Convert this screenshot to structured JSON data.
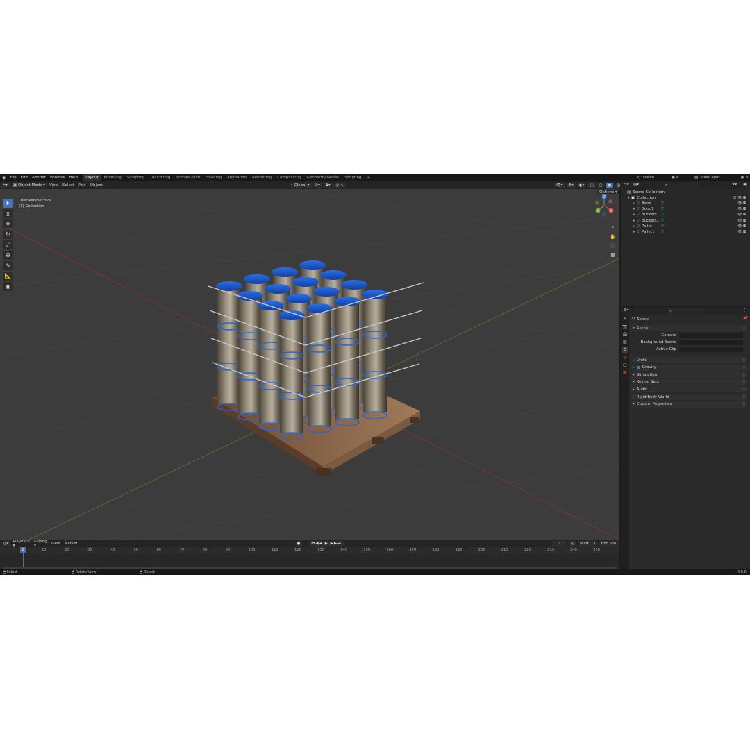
{
  "menu": [
    "File",
    "Edit",
    "Render",
    "Window",
    "Help"
  ],
  "workspaces": [
    "Layout",
    "Modeling",
    "Sculpting",
    "UV Editing",
    "Texture Paint",
    "Shading",
    "Animation",
    "Rendering",
    "Compositing",
    "Geometry Nodes",
    "Scripting",
    "+"
  ],
  "scene_name": "Scene",
  "view_layer": "ViewLayer",
  "viewport": {
    "mode": "Object Mode",
    "menus": [
      "View",
      "Select",
      "Add",
      "Object"
    ],
    "transform_orientation": "Global",
    "options_label": "Options",
    "perspective_label": "User Perspective",
    "collection_label": "(1) Collection",
    "gizmo_axes": [
      "X",
      "Y",
      "Z"
    ]
  },
  "outliner": {
    "root": "Scene Collection",
    "collection": "Collection",
    "items": [
      "Bond",
      "Bond1",
      "Buckets",
      "Buckets1",
      "Pallet",
      "Pallet1"
    ]
  },
  "properties": {
    "header": "Scene",
    "section": "Scene",
    "fields": [
      "Camera",
      "Background Scene",
      "Active Clip"
    ],
    "panels": [
      "Units",
      "Gravity",
      "Simulation",
      "Keying Sets",
      "Audio",
      "Rigid Body World",
      "Custom Properties"
    ]
  },
  "timeline": {
    "menus": [
      "Playback",
      "Keying",
      "View",
      "Marker"
    ],
    "current_frame": "1",
    "start_label": "Start",
    "start": "1",
    "end_label": "End",
    "end": "250",
    "ticks": [
      "10",
      "20",
      "30",
      "40",
      "50",
      "60",
      "70",
      "80",
      "90",
      "100",
      "110",
      "120",
      "130",
      "140",
      "150",
      "160",
      "170",
      "180",
      "190",
      "200",
      "210",
      "220",
      "230",
      "240",
      "250"
    ]
  },
  "status": {
    "select": "Select",
    "rotate": "Rotate View",
    "object": "Object",
    "version": "4.0.0"
  },
  "colors": {
    "accent": "#4772b3",
    "lid_blue": "#1f5fd6",
    "axis_x": "#c74545",
    "axis_y": "#7fa83a"
  }
}
